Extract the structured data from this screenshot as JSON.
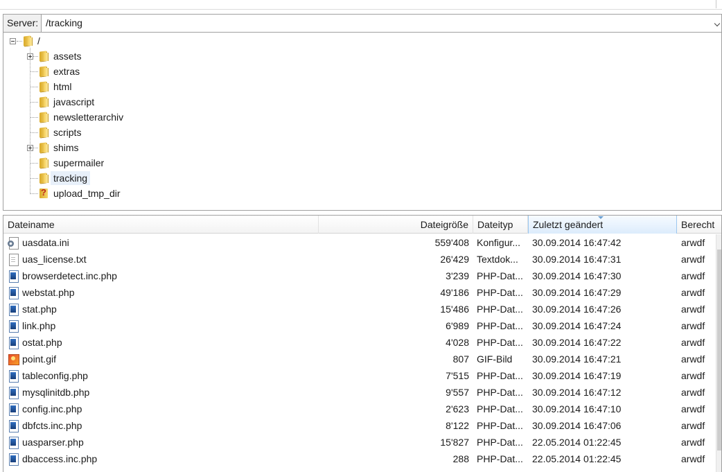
{
  "server_bar": {
    "label": "Server:",
    "path": "/tracking"
  },
  "tree": {
    "root": {
      "label": "/",
      "expanded": true
    },
    "items": [
      {
        "label": "assets",
        "expandable": true,
        "icon": "folder-icon"
      },
      {
        "label": "extras",
        "expandable": false,
        "icon": "folder-icon"
      },
      {
        "label": "html",
        "expandable": false,
        "icon": "folder-icon"
      },
      {
        "label": "javascript",
        "expandable": false,
        "icon": "folder-icon"
      },
      {
        "label": "newsletterarchiv",
        "expandable": false,
        "icon": "folder-icon"
      },
      {
        "label": "scripts",
        "expandable": false,
        "icon": "folder-icon"
      },
      {
        "label": "shims",
        "expandable": true,
        "icon": "folder-icon"
      },
      {
        "label": "supermailer",
        "expandable": false,
        "icon": "folder-icon"
      },
      {
        "label": "tracking",
        "expandable": false,
        "icon": "folder-icon",
        "selected": true
      },
      {
        "label": "upload_tmp_dir",
        "expandable": false,
        "icon": "unknown-folder-icon"
      }
    ]
  },
  "file_list": {
    "columns": {
      "name": "Dateiname",
      "size": "Dateigröße",
      "type": "Dateityp",
      "modified": "Zuletzt geändert",
      "permissions": "Berecht"
    },
    "sorted_column": "modified",
    "files": [
      {
        "name": "uasdata.ini",
        "icon": "ini-file-icon",
        "size": "559'408",
        "type": "Konfigur...",
        "modified": "30.09.2014 16:47:42",
        "permissions": "arwdf"
      },
      {
        "name": "uas_license.txt",
        "icon": "text-file-icon",
        "size": "26'429",
        "type": "Textdok...",
        "modified": "30.09.2014 16:47:31",
        "permissions": "arwdf"
      },
      {
        "name": "browserdetect.inc.php",
        "icon": "php-file-icon",
        "size": "3'239",
        "type": "PHP-Dat...",
        "modified": "30.09.2014 16:47:30",
        "permissions": "arwdf"
      },
      {
        "name": "webstat.php",
        "icon": "php-file-icon",
        "size": "49'186",
        "type": "PHP-Dat...",
        "modified": "30.09.2014 16:47:29",
        "permissions": "arwdf"
      },
      {
        "name": "stat.php",
        "icon": "php-file-icon",
        "size": "15'486",
        "type": "PHP-Dat...",
        "modified": "30.09.2014 16:47:26",
        "permissions": "arwdf"
      },
      {
        "name": "link.php",
        "icon": "php-file-icon",
        "size": "6'989",
        "type": "PHP-Dat...",
        "modified": "30.09.2014 16:47:24",
        "permissions": "arwdf"
      },
      {
        "name": "ostat.php",
        "icon": "php-file-icon",
        "size": "4'028",
        "type": "PHP-Dat...",
        "modified": "30.09.2014 16:47:22",
        "permissions": "arwdf"
      },
      {
        "name": "point.gif",
        "icon": "gif-file-icon",
        "size": "807",
        "type": "GIF-Bild",
        "modified": "30.09.2014 16:47:21",
        "permissions": "arwdf"
      },
      {
        "name": "tableconfig.php",
        "icon": "php-file-icon",
        "size": "7'515",
        "type": "PHP-Dat...",
        "modified": "30.09.2014 16:47:19",
        "permissions": "arwdf"
      },
      {
        "name": "mysqlinitdb.php",
        "icon": "php-file-icon",
        "size": "9'557",
        "type": "PHP-Dat...",
        "modified": "30.09.2014 16:47:12",
        "permissions": "arwdf"
      },
      {
        "name": "config.inc.php",
        "icon": "php-file-icon",
        "size": "2'623",
        "type": "PHP-Dat...",
        "modified": "30.09.2014 16:47:10",
        "permissions": "arwdf"
      },
      {
        "name": "dbfcts.inc.php",
        "icon": "php-file-icon",
        "size": "8'122",
        "type": "PHP-Dat...",
        "modified": "30.09.2014 16:47:06",
        "permissions": "arwdf"
      },
      {
        "name": "uasparser.php",
        "icon": "php-file-icon",
        "size": "15'827",
        "type": "PHP-Dat...",
        "modified": "22.05.2014 01:22:45",
        "permissions": "arwdf"
      },
      {
        "name": "dbaccess.inc.php",
        "icon": "php-file-icon",
        "size": "288",
        "type": "PHP-Dat...",
        "modified": "22.05.2014 01:22:45",
        "permissions": "arwdf"
      }
    ]
  }
}
